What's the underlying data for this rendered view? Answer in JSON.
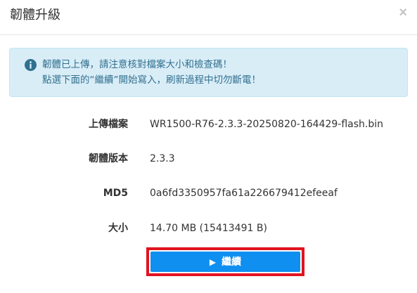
{
  "dialog": {
    "title": "韌體升級",
    "close_icon": "×"
  },
  "alert": {
    "icon": "info-circle-icon",
    "line1": "韌體已上傳，請注意核對檔案大小和檢查碼！",
    "line2": "點選下面的“繼續”開始寫入，刷新過程中切勿斷電！",
    "colors": {
      "background": "#d9edf7",
      "border": "#bce8f1",
      "text": "#31708f"
    }
  },
  "info": [
    {
      "label": "上傳檔案",
      "value": "WR1500-R76-2.3.3-20250820-164429-flash.bin"
    },
    {
      "label": "韌體版本",
      "value": "2.3.3"
    },
    {
      "label": "MD5",
      "value": "0a6fd3350957fa61a226679412efeeaf"
    },
    {
      "label": "大小",
      "value": "14.70 MB (15413491 B)"
    }
  ],
  "continue_button": {
    "icon": "▶",
    "label": "繼續",
    "color": "#0f8ff0",
    "highlight_color": "#e0141e"
  }
}
